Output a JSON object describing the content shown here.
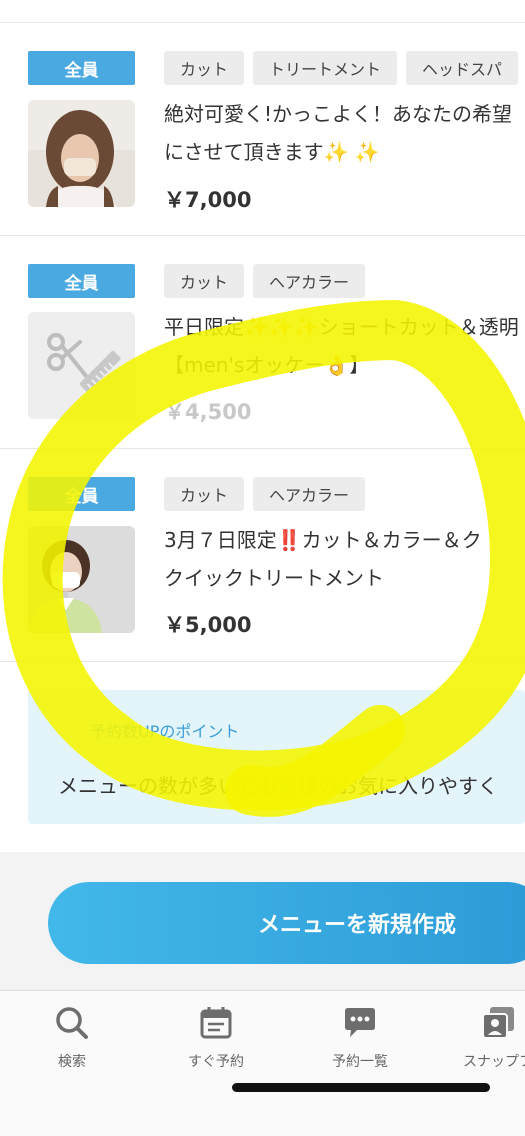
{
  "menus": [
    {
      "badge": "全員",
      "tags": [
        "カット",
        "トリートメント",
        "ヘッドスパ"
      ],
      "title": "絶対可愛く!かっこよく！あなたの希望\nにさせて頂きます✨ ✨",
      "price": "￥7,000",
      "thumb": "photo"
    },
    {
      "badge": "全員",
      "tags": [
        "カット",
        "ヘアカラー"
      ],
      "title": "平日限定✨✨✨ショートカット＆透明\n【men'sオッケー👌】",
      "price": "￥4,500",
      "thumb": "scissors-comb-icon"
    },
    {
      "badge": "全員",
      "tags": [
        "カット",
        "ヘアカラー"
      ],
      "title": "3月７日限定‼️カット＆カラー＆ク\nクイックトリートメント",
      "price": "￥5,000",
      "thumb": "photo"
    }
  ],
  "hint": {
    "title": "予約数UPのポイント",
    "text": "メニューの数が多いとお客様のお気に入りやすく"
  },
  "new_menu_button": "メニューを新規作成",
  "tabs": [
    {
      "label": "検索",
      "icon": "search-icon"
    },
    {
      "label": "すぐ予約",
      "icon": "calendar-icon"
    },
    {
      "label": "予約一覧",
      "icon": "chat-icon"
    },
    {
      "label": "スナップフ",
      "icon": "snap-icon"
    }
  ],
  "colors": {
    "badge": "#4aa9e0",
    "button": "#2c9ad6",
    "highlight": "#f5f500"
  }
}
